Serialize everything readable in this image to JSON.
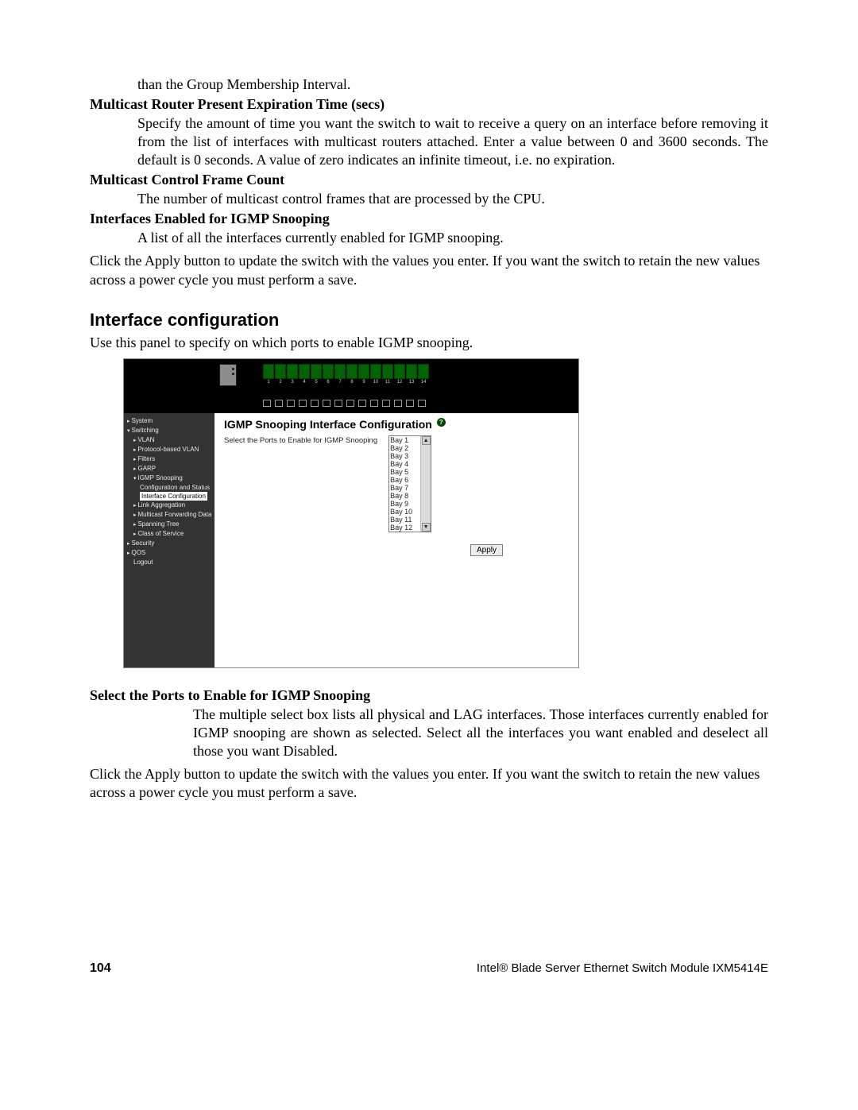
{
  "para_continuation": "than the Group Membership Interval.",
  "term1": "Multicast Router Present Expiration Time (secs)",
  "term1_body": "Specify the amount of time you want the switch to wait to receive a query on an interface before removing it from the list of interfaces with multicast routers attached. Enter a value between 0 and 3600 seconds. The default is 0 seconds. A value of zero indicates an infinite timeout, i.e. no expiration.",
  "term2": "Multicast Control Frame Count",
  "term2_body": "The number of multicast control frames that are processed by the CPU.",
  "term3": "Interfaces Enabled for IGMP Snooping",
  "term3_body": "A list of all the interfaces currently enabled for IGMP snooping.",
  "apply_note1": "Click the Apply button to update the switch with the values you enter. If you want the switch to retain the new values across a power cycle you must perform a save.",
  "section_heading": "Interface configuration",
  "section_intro": "Use this panel to specify on which ports to enable IGMP snooping.",
  "term4": "Select the Ports to Enable for IGMP Snooping",
  "term4_body": "The multiple select box lists all physical and LAG interfaces. Those interfaces currently enabled for IGMP snooping are shown as selected. Select all the interfaces you want enabled and deselect all those you want Disabled.",
  "apply_note2": "Click the Apply button to update the switch with the values you enter. If you want the switch to retain the new values across a power cycle you must perform a save.",
  "footer_page": "104",
  "footer_text": "Intel® Blade Server Ethernet Switch Module IXM5414E",
  "screenshot": {
    "port_numbers": [
      "1",
      "2",
      "3",
      "4",
      "5",
      "6",
      "7",
      "8",
      "9",
      "10",
      "11",
      "12",
      "13",
      "14"
    ],
    "sidebar": {
      "items": [
        {
          "label": "System",
          "cls": "bullet"
        },
        {
          "label": "Switching",
          "cls": "open"
        },
        {
          "label": "VLAN",
          "cls": "bullet l1"
        },
        {
          "label": "Protocol-based VLAN",
          "cls": "bullet l1"
        },
        {
          "label": "Filters",
          "cls": "bullet l1"
        },
        {
          "label": "GARP",
          "cls": "bullet l1"
        },
        {
          "label": "IGMP Snooping",
          "cls": "open l1"
        },
        {
          "label": "Configuration and Status",
          "cls": "l2"
        },
        {
          "label": "Interface Configuration",
          "cls": "l2",
          "sel": true
        },
        {
          "label": "Link Aggregation",
          "cls": "bullet l1"
        },
        {
          "label": "Multicast Forwarding Database",
          "cls": "bullet l1"
        },
        {
          "label": "Spanning Tree",
          "cls": "bullet l1"
        },
        {
          "label": "Class of Service",
          "cls": "bullet l1"
        },
        {
          "label": "Security",
          "cls": "bullet"
        },
        {
          "label": "QOS",
          "cls": "bullet"
        },
        {
          "label": "Logout",
          "cls": "l1"
        }
      ]
    },
    "panel_title": "IGMP Snooping Interface Configuration",
    "field_label": "Select the Ports to Enable for IGMP Snooping",
    "options": [
      "Bay 1",
      "Bay 2",
      "Bay 3",
      "Bay 4",
      "Bay 5",
      "Bay 6",
      "Bay 7",
      "Bay 8",
      "Bay 9",
      "Bay 10",
      "Bay 11",
      "Bay 12"
    ],
    "apply_label": "Apply"
  }
}
